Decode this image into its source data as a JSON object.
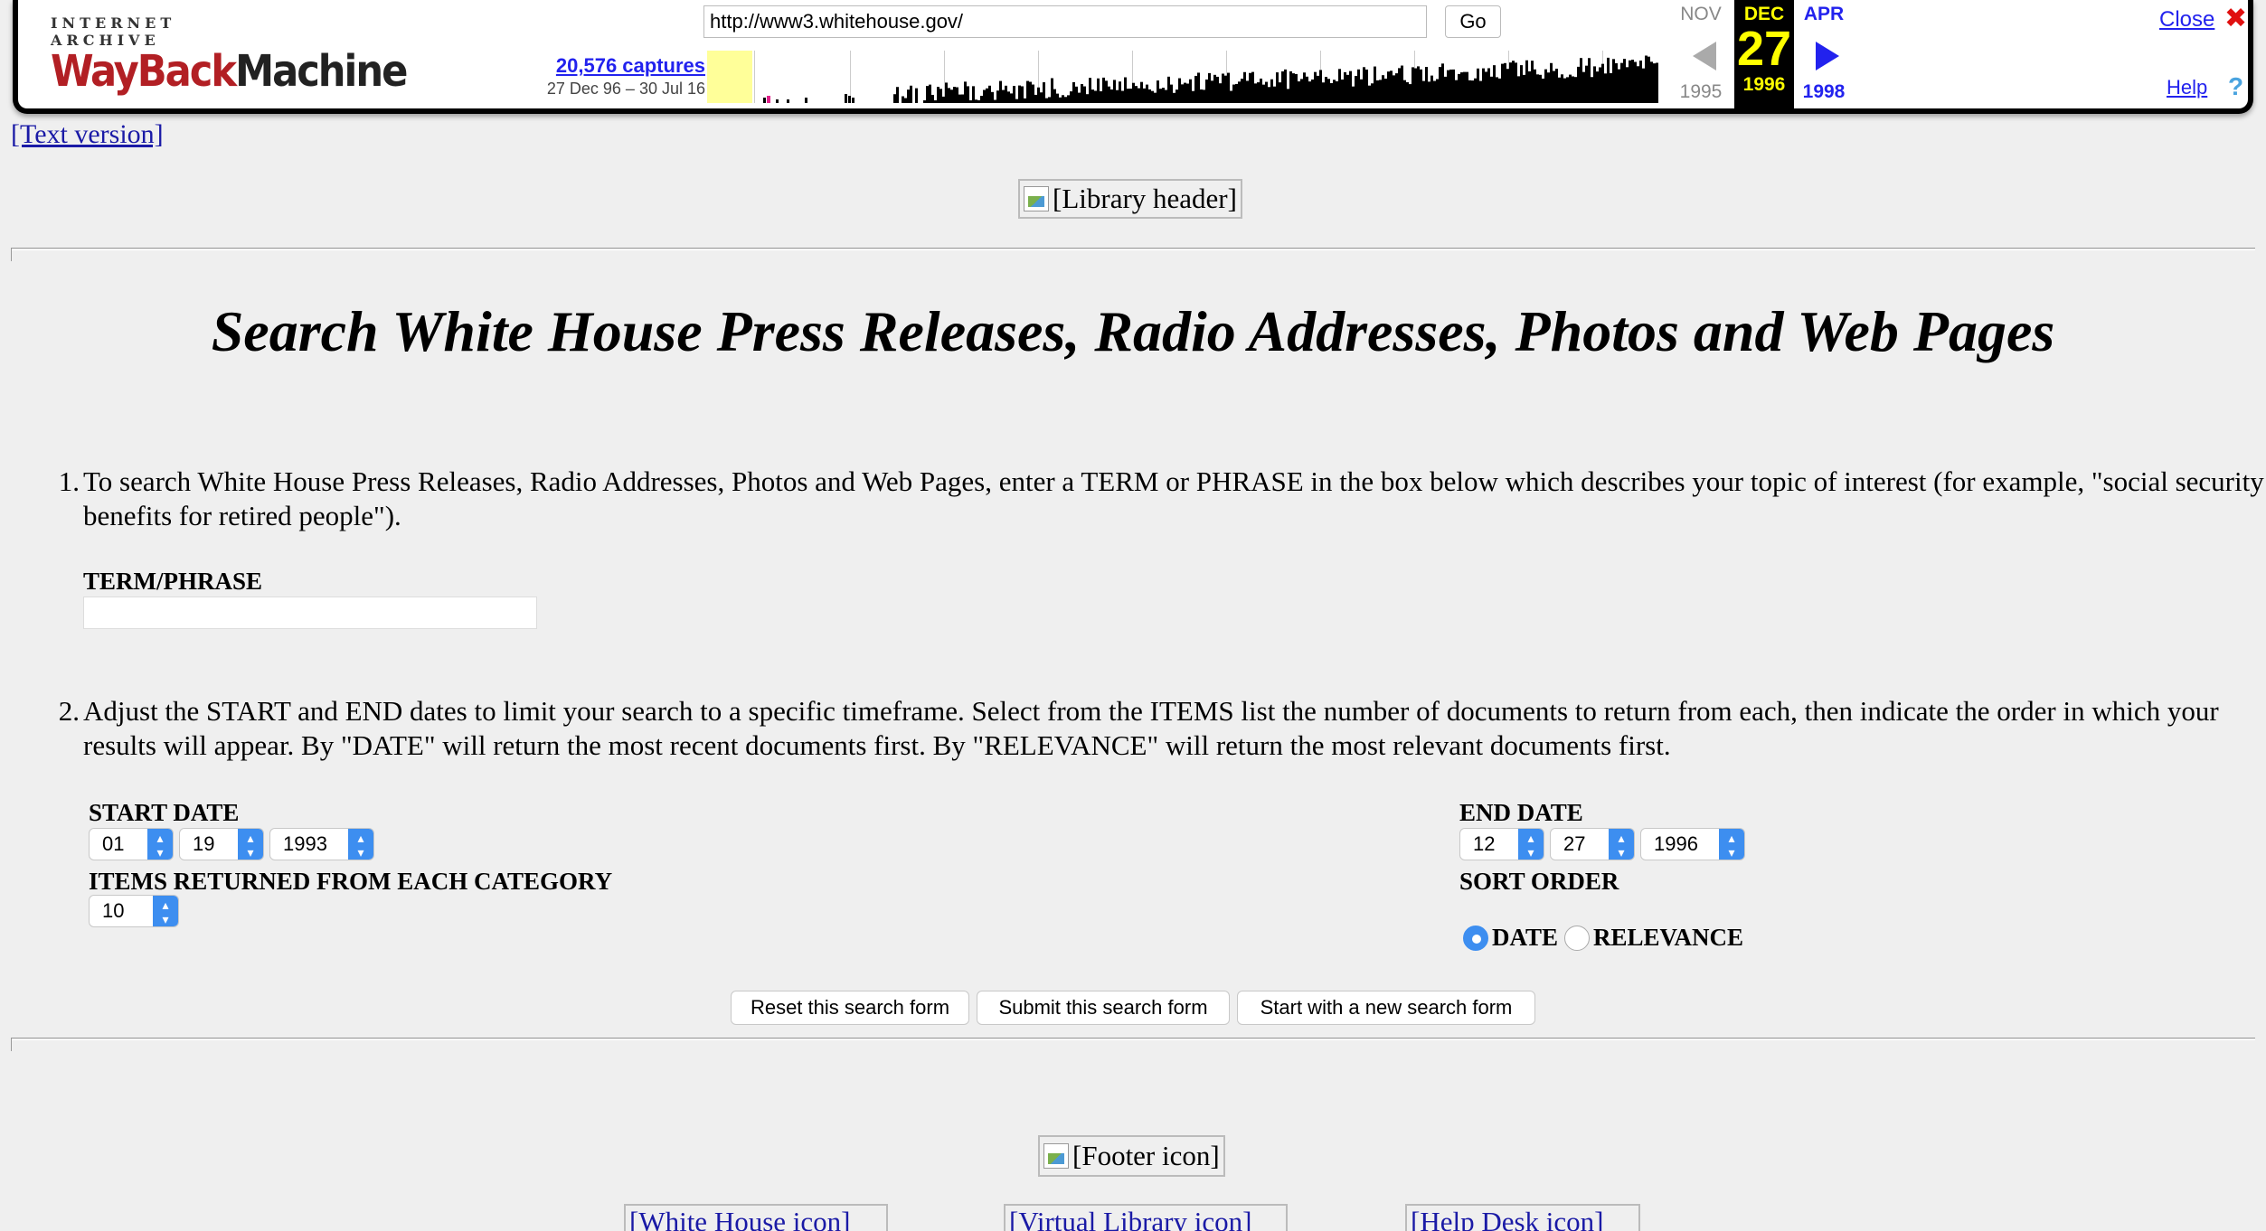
{
  "wayback": {
    "logo_top": "INTERNET ARCHIVE",
    "logo_way": "WayBack",
    "logo_machine": "Machine",
    "url": "http://www3.whitehouse.gov/",
    "go_label": "Go",
    "captures": "20,576 captures",
    "capture_range": "27 Dec 96 – 30 Jul 16",
    "prev_month": "NOV",
    "current_month": "DEC",
    "next_month": "APR",
    "current_day": "27",
    "prev_year": "1995",
    "current_year": "1996",
    "next_year": "1998",
    "close_label": "Close",
    "help_label": "Help",
    "colors": {
      "link": "#2222ee",
      "current_bg": "#000000",
      "current_fg": "#ffff00",
      "close_x": "#e01010"
    }
  },
  "page": {
    "text_version": "[Text version]",
    "library_header_alt": "[Library header]",
    "title": "Search White House Press Releases, Radio Addresses, Photos and Web Pages",
    "steps": [
      {
        "num": "1.",
        "text": "To search White House Press Releases, Radio Addresses, Photos and Web Pages, enter a TERM or PHRASE in the box below which describes your topic of interest (for example, \"social security benefits for retired people\")."
      },
      {
        "num": "2.",
        "text": "Adjust the START and END dates to limit your search to a specific timeframe. Select from the ITEMS list the number of documents to return from each, then indicate the order in which your results will appear. By \"DATE\" will return the most recent documents first. By \"RELEVANCE\" will return the most relevant documents first."
      }
    ],
    "term_label": "TERM/PHRASE",
    "term_value": "",
    "start_label": "START DATE",
    "start_month": "01",
    "start_day": "19",
    "start_year": "1993",
    "end_label": "END DATE",
    "end_month": "12",
    "end_day": "27",
    "end_year": "1996",
    "items_label": "ITEMS RETURNED FROM EACH CATEGORY",
    "items_value": "10",
    "sort_label": "SORT ORDER",
    "sort_options": [
      "DATE",
      "RELEVANCE"
    ],
    "sort_selected": "DATE",
    "buttons": {
      "reset": "Reset this search form",
      "submit": "Submit this search form",
      "new": "Start with a new search form"
    },
    "footer_icon_alt": "[Footer icon]",
    "footer_links": [
      "[White House icon]",
      "[Virtual Library icon]",
      "[Help Desk icon]"
    ]
  }
}
